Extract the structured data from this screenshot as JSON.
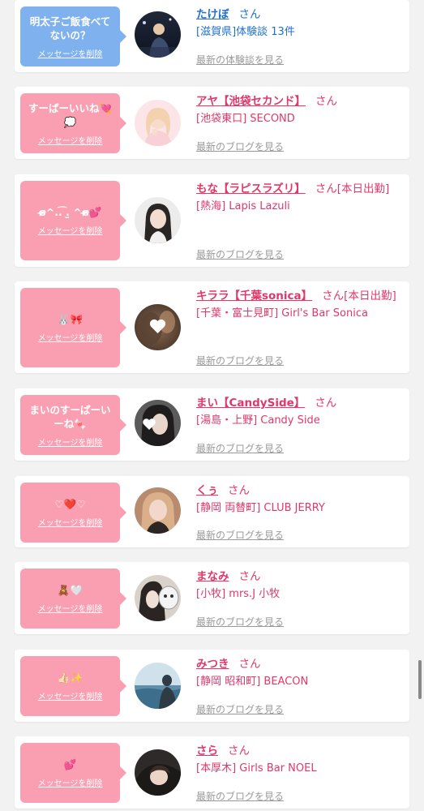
{
  "delete_label": "メッセージを削除",
  "suffix": "さん",
  "colors": {
    "blue_bubble": "#7eb1ee",
    "pink_bubble": "#f99fb1",
    "blue_text": "#1f6fd6",
    "pink_text": "#e0386a",
    "gray_link": "#9a9a9a"
  },
  "items": [
    {
      "theme": "blue",
      "message": "明太子ご飯食べてないの？",
      "name": "たけぼ",
      "status": "",
      "shop": "[滋賀県]体験談 13件",
      "link": "最新の体験談を見る",
      "avatar": "photo-man-night"
    },
    {
      "theme": "pink",
      "message": "すーぱーいいね💘💭",
      "name": "アヤ【池袋セカンド】",
      "status": "",
      "shop": "[池袋東口] SECOND",
      "link": "最新のブログを見る",
      "avatar": "photo-woman-pink"
    },
    {
      "theme": "pink",
      "message": "ɞ̴̶̷^..͡ .̫ ^ɞ̴̶̷💕",
      "name": "もな【ラピスラズリ】",
      "status": "[本日出勤]",
      "shop": "[熱海] Lapis Lazuli",
      "link": "最新のブログを見る",
      "avatar": "photo-woman-dark-hair"
    },
    {
      "theme": "pink",
      "message": "🐰🎀",
      "name": "キララ【千葉sonica】",
      "status": "[本日出勤]",
      "shop": "[千葉・富士見町] Girl's Bar Sonica",
      "link": "最新のブログを見る",
      "avatar": "photo-heart-overlay"
    },
    {
      "theme": "pink",
      "message": "まいのすーぱーいーね🍬",
      "name": "まい【CandySide】",
      "status": "",
      "shop": "[湯島・上野] Candy Side",
      "link": "最新のブログを見る",
      "avatar": "photo-heart-overlay-2"
    },
    {
      "theme": "pink",
      "message": "♡❤️♡",
      "name": "くぅ",
      "status": "",
      "shop": "[静岡 両替町] CLUB JERRY",
      "link": "最新のブログを見る",
      "avatar": "photo-woman-blonde"
    },
    {
      "theme": "pink",
      "message": "🧸🤍",
      "name": "まなみ",
      "status": "",
      "shop": "[小牧] mrs.J 小牧",
      "link": "最新のブログを見る",
      "avatar": "photo-woman-cup"
    },
    {
      "theme": "pink",
      "message": "👍🏻✨",
      "name": "みつき",
      "status": "",
      "shop": "[静岡 昭和町] BEACON",
      "link": "最新のブログを見る",
      "avatar": "photo-sea-view"
    },
    {
      "theme": "pink",
      "message": "💕",
      "name": "さら",
      "status": "",
      "shop": "[本厚木] Girls Bar NOEL",
      "link": "最新のブログを見る",
      "avatar": "photo-woman-lying"
    }
  ]
}
